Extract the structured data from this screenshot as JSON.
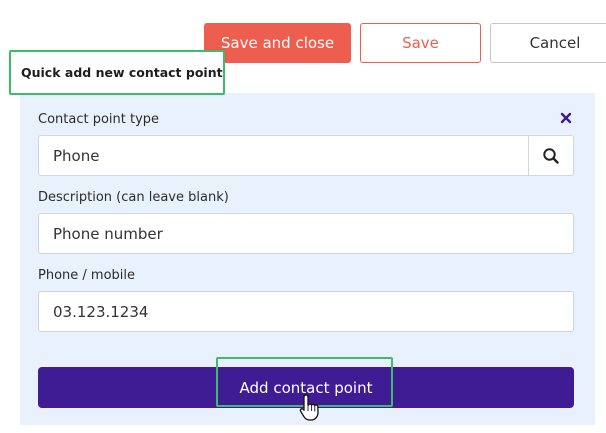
{
  "actions": {
    "save_and_close_label": "Save and close",
    "save_label": "Save",
    "cancel_label": "Cancel"
  },
  "panel": {
    "title": "Quick add new contact point",
    "contact_point_type": {
      "label": "Contact point type",
      "value": "Phone",
      "lookup_icon": "search-icon"
    },
    "close_icon": "close-icon",
    "description": {
      "label": "Description (can leave blank)",
      "value": "Phone number"
    },
    "phone": {
      "label": "Phone / mobile",
      "value": "03.123.1234"
    },
    "add_button_label": "Add contact point"
  },
  "colors": {
    "primary": "#3f1b94",
    "accent": "#ed5e4f",
    "highlight": "#3dbd6b",
    "panel_bg": "#e9f2fc"
  }
}
